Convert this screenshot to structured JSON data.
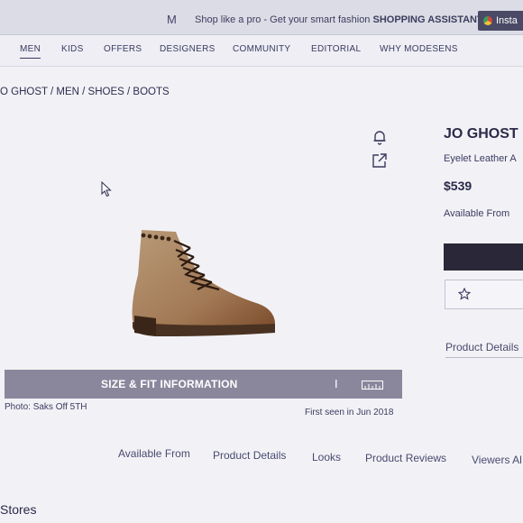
{
  "topbar": {
    "logo": "M",
    "promo_text": "Shop like a pro - Get your smart fashion ",
    "promo_bold": "SHOPPING ASSISTANT",
    "install_label": "Insta"
  },
  "nav": {
    "items": [
      "MEN",
      "KIDS",
      "OFFERS",
      "DESIGNERS",
      "COMMUNITY",
      "EDITORIAL",
      "WHY MODESENS"
    ]
  },
  "breadcrumb": "O GHOST / MEN / SHOES / BOOTS",
  "size_bar": {
    "label": "SIZE & FIT INFORMATION",
    "separator": "I"
  },
  "photo_credit": "Photo: Saks Off 5TH",
  "first_seen": "First seen in Jun 2018",
  "product": {
    "brand": "JO GHOST",
    "name": "Eyelet Leather A",
    "price": "$539",
    "available_from": "Available From",
    "details_link": "Product Details"
  },
  "tabs": [
    "Available From",
    "Product Details",
    "Looks",
    "Product Reviews",
    "Viewers Al"
  ],
  "stores_heading": "Stores",
  "colors": {
    "accent": "#2b2a4a",
    "size_bar": "#8a879d",
    "buy_button": "#2a2838"
  },
  "icons": [
    "bell-icon",
    "share-icon",
    "star-icon",
    "ruler-icon",
    "chrome-icon",
    "cursor-icon"
  ]
}
